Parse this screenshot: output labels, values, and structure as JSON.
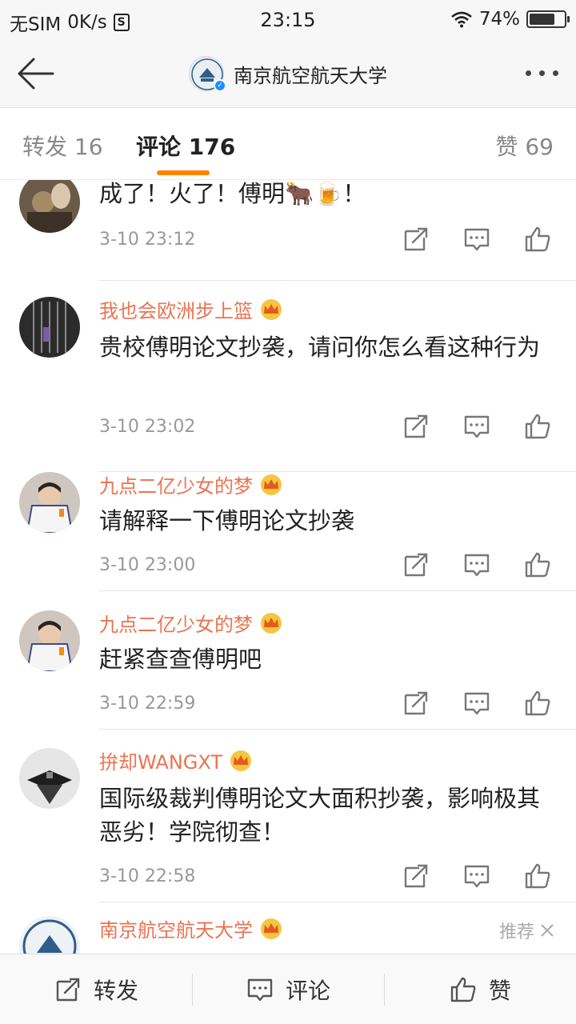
{
  "status_bar": {
    "carrier": "无SIM",
    "speed": "0K/s",
    "s_icon": "S",
    "time": "23:15",
    "battery": "74%",
    "battery_level": 0.74
  },
  "nav": {
    "title": "南京航空航天大学"
  },
  "tabs": {
    "repost": "转发 16",
    "comments": "评论 176",
    "likes": "赞 69"
  },
  "comments": [
    {
      "author": "",
      "text": "成了！火了！傅明🐂🍺！",
      "time": "3-10 23:12"
    },
    {
      "author": "我也会欧洲步上篮",
      "text": "贵校傅明论文抄袭，请问你怎么看这种行为",
      "time": "3-10 23:02"
    },
    {
      "author": "九点二亿少女的梦",
      "text": "请解释一下傅明论文抄袭",
      "time": "3-10 23:00"
    },
    {
      "author": "九点二亿少女的梦",
      "text": "赶紧查查傅明吧",
      "time": "3-10 22:59"
    },
    {
      "author": "拚却WANGXT",
      "text": "国际级裁判傅明论文大面积抄袭，影响极其恶劣！学院彻查！",
      "time": "3-10 22:58"
    },
    {
      "author": "南京航空航天大学",
      "recommend": "推荐"
    }
  ],
  "bottom_bar": {
    "repost": "转发",
    "comment": "评论",
    "like": "赞"
  },
  "colors": {
    "accent": "#ff8200",
    "author": "#eb7350",
    "verified": "#1e90ff"
  }
}
